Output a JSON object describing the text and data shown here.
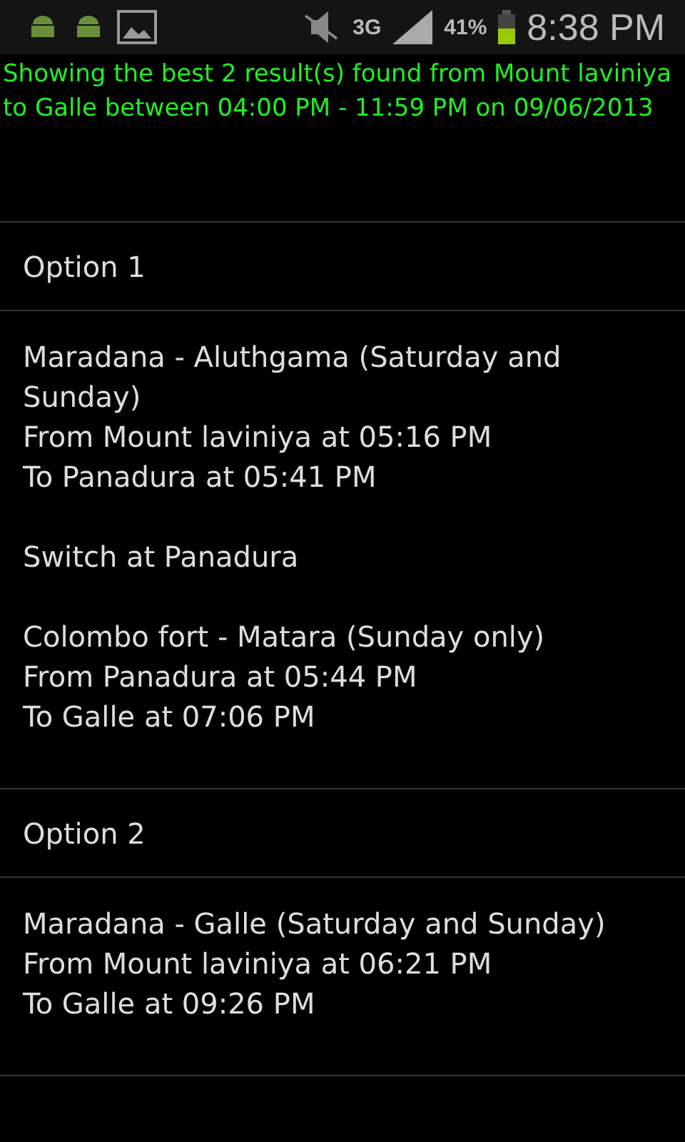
{
  "status_bar": {
    "network": "3G",
    "battery": "41%",
    "time": "8:38 PM"
  },
  "summary": "Showing the best 2 result(s) found from Mount laviniya to Galle between 04:00 PM - 11:59 PM on 09/06/2013",
  "options": [
    {
      "title": "Option 1",
      "blocks": [
        [
          "Maradana - Aluthgama (Saturday and Sunday)",
          "From Mount laviniya at 05:16 PM",
          "To Panadura at 05:41 PM"
        ],
        [
          "Switch at Panadura"
        ],
        [
          "Colombo fort - Matara (Sunday only)",
          "From Panadura at 05:44 PM",
          "To Galle at 07:06 PM"
        ]
      ]
    },
    {
      "title": "Option 2",
      "blocks": [
        [
          "Maradana - Galle (Saturday and Sunday)",
          "From Mount laviniya at 06:21 PM",
          "To Galle at 09:26 PM"
        ]
      ]
    }
  ]
}
